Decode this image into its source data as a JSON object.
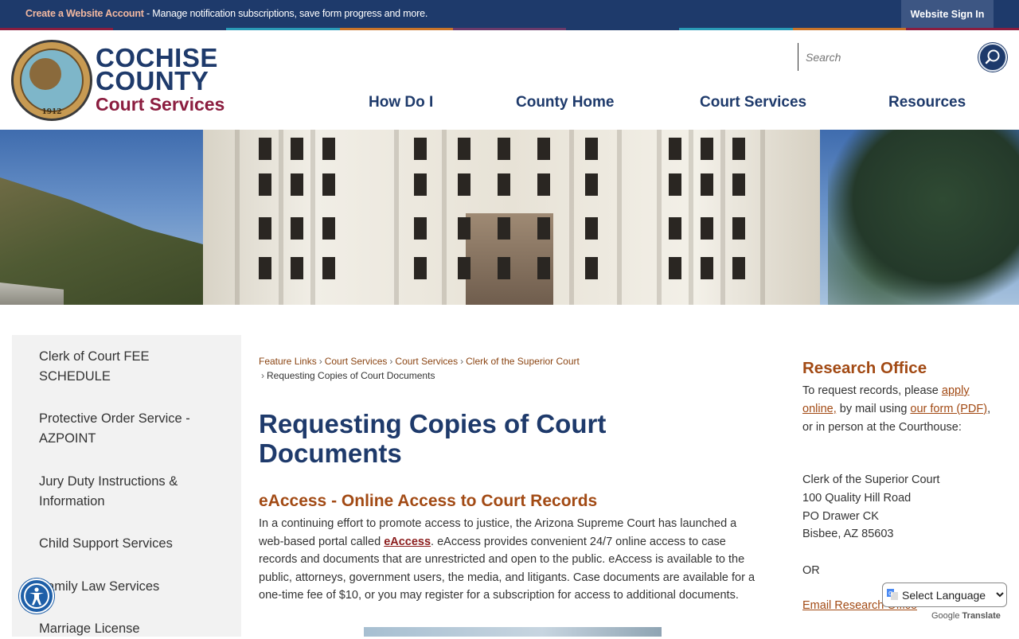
{
  "topbar": {
    "create_link": "Create a Website Account",
    "message": " - Manage notification subscriptions, save form progress and more.",
    "signin": "Website Sign In"
  },
  "colors": {
    "navy": "#1e3a6b",
    "maroon": "#8b1d3f",
    "accent_orange": "#a24a14",
    "stripe": [
      "#8b1d3f",
      "#1e3a6b",
      "#2a9bb7",
      "#c9742a",
      "#6b3a6b",
      "#1e3a6b",
      "#2a9bb7",
      "#c9742a",
      "#8b1d3f"
    ]
  },
  "header": {
    "logo_line1": "COCHISE",
    "logo_line2": "COUNTY",
    "logo_line3": "Court Services",
    "seal_year": "1912",
    "search_placeholder": "Search"
  },
  "nav": [
    {
      "label": "How Do I"
    },
    {
      "label": "County Home"
    },
    {
      "label": "Court Services"
    },
    {
      "label": "Resources"
    }
  ],
  "sidebar": {
    "items": [
      {
        "label": "Clerk of Court FEE SCHEDULE"
      },
      {
        "label": "Protective Order Service - AZPOINT"
      },
      {
        "label": "Jury Duty Instructions & Information"
      },
      {
        "label": "Child Support Services"
      },
      {
        "label": "Family Law Services"
      },
      {
        "label": "Marriage License"
      }
    ]
  },
  "breadcrumb": {
    "links": [
      "Feature Links",
      "Court Services",
      "Court Services",
      "Clerk of the Superior Court"
    ],
    "separator": "›",
    "current": "Requesting Copies of Court Documents"
  },
  "main": {
    "title": "Requesting Copies of Court Documents",
    "subtitle": "eAccess - Online Access to Court Records",
    "para_part1": "In a continuing effort to promote access to justice, the Arizona Supreme Court has launched a web-based portal called ",
    "para_link": "eAccess",
    "para_part2": ". eAccess provides convenient 24/7 online access to case records and documents that are unrestricted and open to the public. eAccess is available to the public, attorneys, government users, the media, and litigants. Case documents are available for a one-time fee of $10, or you may register for a subscription for access to additional documents."
  },
  "research": {
    "title": "Research Office",
    "intro_part1": "To request records, please ",
    "link_apply": "apply online,",
    "intro_part2": " by mail using ",
    "link_form": "our form (PDF)",
    "intro_part3": ", or in person at the Courthouse:",
    "address": [
      "Clerk of the Superior Court",
      "100 Quality Hill Road",
      "PO Drawer CK",
      "Bisbee, AZ 85603"
    ],
    "or": "OR",
    "email_link": "Email Research Office"
  },
  "translate": {
    "select_label": "Select Language",
    "powered_by": "Google",
    "translate_word": "Translate"
  }
}
